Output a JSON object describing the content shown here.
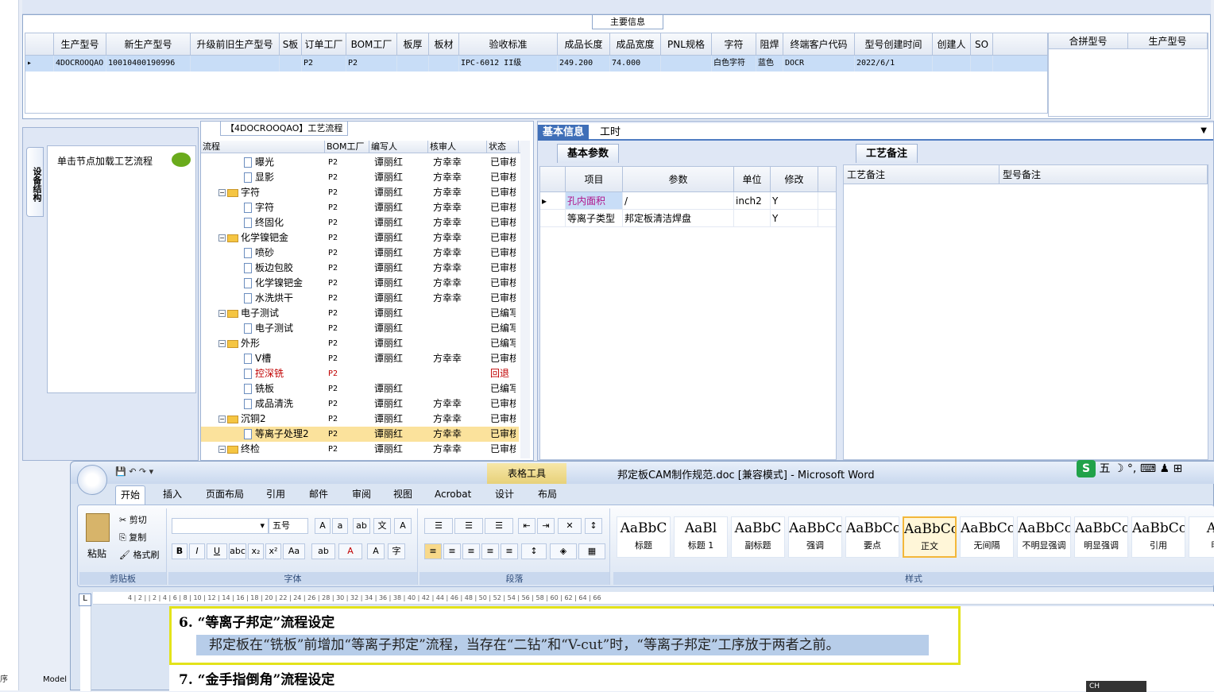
{
  "left_strip": {
    "label": "序",
    "model_label": "Model"
  },
  "main_info": {
    "title": "主要信息",
    "columns": [
      "生产型号",
      "新生产型号",
      "升级前旧生产型号",
      "S板",
      "订单工厂",
      "BOM工厂",
      "板厚",
      "板材",
      "验收标准",
      "成品长度",
      "成品宽度",
      "PNL规格",
      "字符",
      "阻焊",
      "终端客户代码",
      "型号创建时间",
      "创建人",
      "SO"
    ],
    "row": [
      "4DOCROOQAO",
      "10010400190996",
      "",
      "",
      "P2",
      "P2",
      "",
      "",
      "IPC-6012 II级",
      "249.200",
      "74.000",
      "",
      "白色字符",
      "蓝色",
      "DOCR",
      "2022/6/1",
      "",
      ""
    ],
    "right_columns": [
      "合拼型号",
      "生产型号"
    ]
  },
  "left_panel": {
    "vtab": "设备结构",
    "load_text": "单击节点加载工艺流程"
  },
  "process_tree": {
    "title": "【4DOCROOQAO】工艺流程",
    "columns": [
      "流程",
      "BOM工厂",
      "编写人",
      "核审人",
      "状态"
    ],
    "rows": [
      {
        "type": "doc",
        "name": "曝光",
        "bom": "P2",
        "writer": "谭丽红",
        "checker": "方幸幸",
        "status": "已审核"
      },
      {
        "type": "doc",
        "name": "显影",
        "bom": "P2",
        "writer": "谭丽红",
        "checker": "方幸幸",
        "status": "已审核"
      },
      {
        "type": "folder",
        "name": "字符",
        "bom": "P2",
        "writer": "谭丽红",
        "checker": "方幸幸",
        "status": "已审核"
      },
      {
        "type": "doc",
        "name": "字符",
        "bom": "P2",
        "writer": "谭丽红",
        "checker": "方幸幸",
        "status": "已审核"
      },
      {
        "type": "doc",
        "name": "终固化",
        "bom": "P2",
        "writer": "谭丽红",
        "checker": "方幸幸",
        "status": "已审核"
      },
      {
        "type": "folder",
        "name": "化学镍钯金",
        "bom": "P2",
        "writer": "谭丽红",
        "checker": "方幸幸",
        "status": "已审核"
      },
      {
        "type": "doc",
        "name": "喷砂",
        "bom": "P2",
        "writer": "谭丽红",
        "checker": "方幸幸",
        "status": "已审核"
      },
      {
        "type": "doc",
        "name": "板边包胶",
        "bom": "P2",
        "writer": "谭丽红",
        "checker": "方幸幸",
        "status": "已审核"
      },
      {
        "type": "doc",
        "name": "化学镍钯金",
        "bom": "P2",
        "writer": "谭丽红",
        "checker": "方幸幸",
        "status": "已审核"
      },
      {
        "type": "doc",
        "name": "水洗烘干",
        "bom": "P2",
        "writer": "谭丽红",
        "checker": "方幸幸",
        "status": "已审核"
      },
      {
        "type": "folder",
        "name": "电子测试",
        "bom": "P2",
        "writer": "谭丽红",
        "checker": "",
        "status": "已编写"
      },
      {
        "type": "doc",
        "name": "电子测试",
        "bom": "P2",
        "writer": "谭丽红",
        "checker": "",
        "status": "已编写"
      },
      {
        "type": "folder",
        "name": "外形",
        "bom": "P2",
        "writer": "谭丽红",
        "checker": "",
        "status": "已编写"
      },
      {
        "type": "doc",
        "name": "V槽",
        "bom": "P2",
        "writer": "谭丽红",
        "checker": "方幸幸",
        "status": "已审核"
      },
      {
        "type": "doc",
        "name": "控深铣",
        "bom": "P2",
        "writer": "",
        "checker": "",
        "status": "回退",
        "red": true
      },
      {
        "type": "doc",
        "name": "铣板",
        "bom": "P2",
        "writer": "谭丽红",
        "checker": "",
        "status": "已编写"
      },
      {
        "type": "doc",
        "name": "成品清洗",
        "bom": "P2",
        "writer": "谭丽红",
        "checker": "方幸幸",
        "status": "已审核"
      },
      {
        "type": "folder",
        "name": "沉铜2",
        "bom": "P2",
        "writer": "谭丽红",
        "checker": "方幸幸",
        "status": "已审核"
      },
      {
        "type": "doc",
        "name": "等离子处理2",
        "bom": "P2",
        "writer": "谭丽红",
        "checker": "方幸幸",
        "status": "已审核",
        "selected": true
      },
      {
        "type": "folder",
        "name": "终检",
        "bom": "P2",
        "writer": "谭丽红",
        "checker": "方幸幸",
        "status": "已审核"
      }
    ]
  },
  "info_panel": {
    "tabs": [
      "基本信息",
      "工时"
    ],
    "params_tab": "基本参数",
    "remarks_tab": "工艺备注",
    "param_columns": [
      "项目",
      "参数",
      "单位",
      "修改"
    ],
    "params": [
      {
        "item": "孔内面积",
        "value": "/",
        "unit": "inch2",
        "edit": "Y"
      },
      {
        "item": "等离子类型",
        "value": "邦定板清洁焊盘",
        "unit": "",
        "edit": "Y"
      }
    ],
    "remark_columns": [
      "工艺备注",
      "型号备注"
    ]
  },
  "word": {
    "title": "邦定板CAM制作规范.doc [兼容模式] - Microsoft Word",
    "context_tab": "表格工具",
    "tabs": [
      "开始",
      "插入",
      "页面布局",
      "引用",
      "邮件",
      "审阅",
      "视图",
      "Acrobat",
      "设计",
      "布局"
    ],
    "clipboard": {
      "paste": "粘贴",
      "cut": "剪切",
      "copy": "复制",
      "format_painter": "格式刷",
      "label": "剪贴板"
    },
    "font": {
      "size": "五号",
      "label": "字体"
    },
    "paragraph_label": "段落",
    "styles_label": "样式",
    "styles": [
      {
        "preview": "AaBbC",
        "name": "标题"
      },
      {
        "preview": "AaBl",
        "name": "标题 1"
      },
      {
        "preview": "AaBbC",
        "name": "副标题"
      },
      {
        "preview": "AaBbCcDd",
        "name": "强调"
      },
      {
        "preview": "AaBbCcD",
        "name": "要点"
      },
      {
        "preview": "AaBbCcDd",
        "name": "正文",
        "selected": true
      },
      {
        "preview": "AaBbCcDd",
        "name": "无间隔"
      },
      {
        "preview": "AaBbCcDd",
        "name": "不明显强调"
      },
      {
        "preview": "AaBbCcDd",
        "name": "明显强调"
      },
      {
        "preview": "AaBbCcDd",
        "name": "引用"
      },
      {
        "preview": "Aa",
        "name": "明"
      }
    ],
    "ruler_text": "4 | 2 | | 2 | 4 | 6 | 8 | 10 | 12 | 14 | 16 | 18 | 20 | 22 | 24 | 26 | 28 | 30 | 32 | 34 | 36 | 38 | 40 | 42 | 44 | 46 | 48 | 50 | 52 | 54 | 56 | 58 | 60 | 62 | 64 | 66",
    "doc": {
      "h6": "6.   “等离子邦定”流程设定",
      "p6": "邦定板在“铣板”前增加“等离子邦定”流程，当存在“二钻”和“V-cut”时，“等离子邦定”工序放于两者之前。",
      "h7": "7.   “金手指倒角”流程设定"
    },
    "ime": {
      "logo": "S",
      "mode": "五"
    },
    "ime_small": "CH"
  }
}
